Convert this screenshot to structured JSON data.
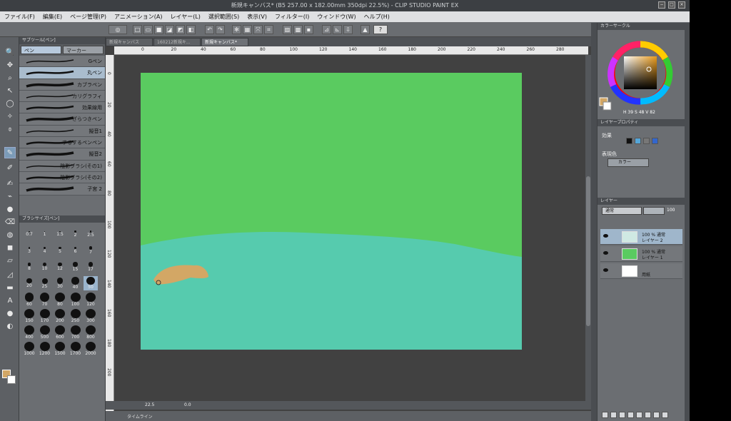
{
  "window": {
    "title": "新規キャンバス* (B5 257.00 x 182.00mm 350dpi 22.5%) - CLIP STUDIO PAINT EX"
  },
  "menu": [
    "ファイル(F)",
    "編集(E)",
    "ページ管理(P)",
    "アニメーション(A)",
    "レイヤー(L)",
    "選択範囲(S)",
    "表示(V)",
    "フィルター(I)",
    "ウィンドウ(W)",
    "ヘルプ(H)"
  ],
  "subtool": {
    "header": "サブツール[ペン]",
    "tabs": [
      "ペン",
      "マーカー"
    ],
    "brushes": [
      "Gペン",
      "丸ペン",
      "カブラペン",
      "カリグラフィ",
      "効果線用",
      "ざらつきペン",
      "擬音1",
      "するするペンペン",
      "擬音2",
      "陰影ブラシ(その1)",
      "陰影ブラシ(その2)",
      "子宮 2"
    ],
    "active_brush_index": 1
  },
  "brush_size": {
    "header": "ブラシサイズ[ペン]",
    "sizes": [
      "0.7",
      "1",
      "1.5",
      "2",
      "2.5",
      "3",
      "4",
      "5",
      "6",
      "7",
      "8",
      "10",
      "12",
      "15",
      "17",
      "20",
      "25",
      "30",
      "40",
      "50",
      "60",
      "70",
      "80",
      "100",
      "120",
      "150",
      "170",
      "200",
      "250",
      "300",
      "400",
      "500",
      "600",
      "700",
      "800",
      "1000",
      "1200",
      "1500",
      "1700",
      "2000"
    ],
    "active": "50"
  },
  "doc_tabs": [
    "新規キャンバス",
    "160212新規キ...",
    "新規キャンバス*"
  ],
  "ruler": {
    "h_ticks": [
      "0",
      "20",
      "40",
      "60",
      "80",
      "100",
      "120",
      "140",
      "160",
      "180",
      "200",
      "220",
      "240",
      "260",
      "280"
    ],
    "v_ticks": [
      "0",
      "20",
      "40",
      "60",
      "80",
      "100",
      "120",
      "140",
      "160",
      "180",
      "200"
    ]
  },
  "status": {
    "zoom": "22.5",
    "angle": "0.0"
  },
  "timeline": {
    "label": "タイムライン"
  },
  "colors": {
    "main": "#d3a765",
    "sub": "#ffffff",
    "canvas_top": "#5acb60",
    "canvas_water": "#56cbae",
    "blob": "#d3a765"
  },
  "color_panel": {
    "header": "カラーサークル",
    "h": "39",
    "s": "48",
    "v": "82"
  },
  "layer_property": {
    "header": "レイヤープロパティ",
    "effect_label": "効果",
    "expression_label": "表現色",
    "expression_value": "カラー"
  },
  "layers": {
    "header": "レイヤー",
    "blend_mode": "通常",
    "opacity": "100",
    "items": [
      {
        "line1": "100 % 通常",
        "line2": "レイヤー 2",
        "active": true
      },
      {
        "line1": "100 % 通常",
        "line2": "レイヤー 1",
        "active": false
      },
      {
        "line1": "",
        "line2": "用紙",
        "active": false
      }
    ]
  }
}
